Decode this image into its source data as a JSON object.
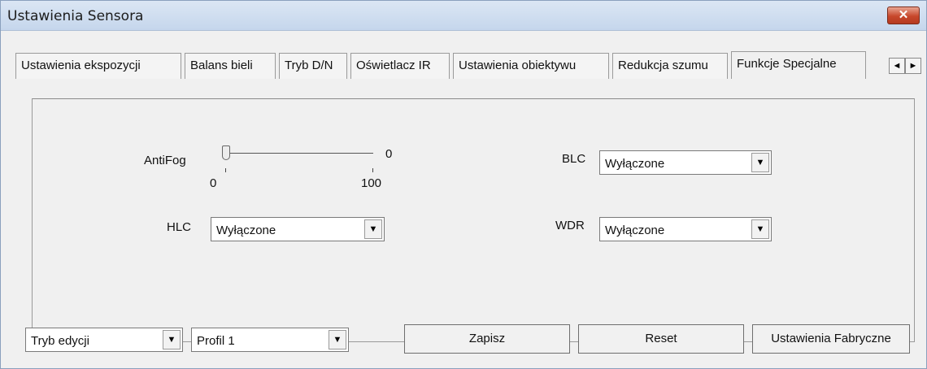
{
  "window": {
    "title": "Ustawienia Sensora",
    "close_label": "✕"
  },
  "tabs": [
    {
      "label": "Ustawienia ekspozycji"
    },
    {
      "label": "Balans bieli"
    },
    {
      "label": "Tryb D/N"
    },
    {
      "label": "Oświetlacz IR"
    },
    {
      "label": "Ustawienia obiektywu"
    },
    {
      "label": "Redukcja szumu"
    },
    {
      "label": "Funkcje Specjalne",
      "active": true
    }
  ],
  "tab_scroll": {
    "left": "◄",
    "right": "►"
  },
  "panel": {
    "antifog": {
      "label": "AntiFog",
      "value": "0",
      "value_numeric": 0,
      "min": "0",
      "max": "100"
    },
    "blc": {
      "label": "BLC",
      "selected": "Wyłączone"
    },
    "hlc": {
      "label": "HLC",
      "selected": "Wyłączone"
    },
    "wdr": {
      "label": "WDR",
      "selected": "Wyłączone"
    }
  },
  "combo_arrow": "▼",
  "footer": {
    "mode_select": "Tryb edycji",
    "profile_select": "Profil 1",
    "save_label": "Zapisz",
    "reset_label": "Reset",
    "factory_label": "Ustawienia Fabryczne"
  }
}
